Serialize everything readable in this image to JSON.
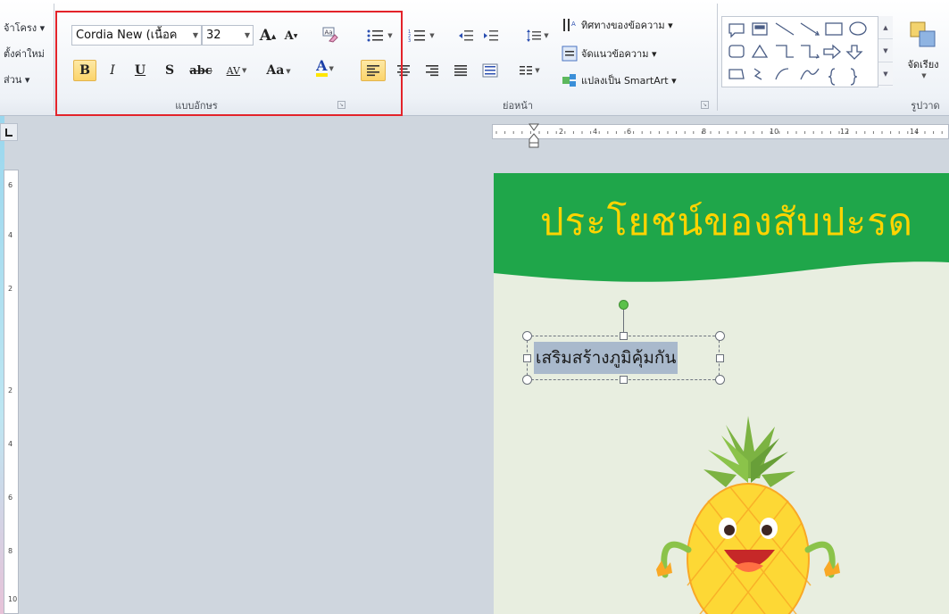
{
  "ribbon": {
    "left_group": {
      "items": [
        "จ้าโครง ▾",
        "ตั้งค่าใหม่",
        "ส่วน ▾"
      ]
    },
    "font_group": {
      "label": "แบบอักษร",
      "font_name": "Cordia New (เนื้อค",
      "font_size": "32",
      "grow_font": "A",
      "shrink_font": "A",
      "bold": "B",
      "italic": "I",
      "underline": "U",
      "shadow": "S",
      "strikethrough": "abc",
      "char_spacing": "AV",
      "change_case": "Aa",
      "font_color": "A"
    },
    "paragraph_group": {
      "label": "ย่อหน้า",
      "text_direction": "ทิศทางของข้อความ ▾",
      "align_text": "จัดแนวข้อความ ▾",
      "convert_smartart": "แปลงเป็น SmartArt ▾"
    },
    "drawing_group": {
      "label": "รูปวาด",
      "arrange": "จัดเรียง"
    }
  },
  "ruler": {
    "h_numbers": [
      "2",
      "4",
      "6",
      "8",
      "10",
      "12",
      "14"
    ],
    "v_numbers": [
      "6",
      "4",
      "2",
      "2",
      "4",
      "6",
      "8",
      "10"
    ]
  },
  "slide": {
    "title": "ประโยชน์ของสับปะรด",
    "textbox_text": "เสริมสร้างภูมิคุ้มกัน"
  },
  "colors": {
    "slide_band": "#1fa64a",
    "slide_title": "#ffd400",
    "highlight_border": "#e3232a",
    "selection_fill": "#a9b9cc"
  }
}
